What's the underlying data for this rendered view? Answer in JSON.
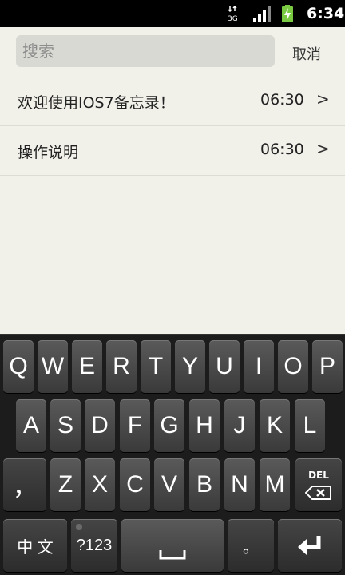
{
  "status_bar": {
    "network": "3G",
    "time": "6:34"
  },
  "search": {
    "placeholder": "搜索",
    "cancel_label": "取消"
  },
  "notes": [
    {
      "title": "欢迎使用IOS7备忘录！",
      "time": "06:30",
      "chevron": ">"
    },
    {
      "title": "操作说明",
      "time": "06:30",
      "chevron": ">"
    }
  ],
  "keyboard": {
    "row1": [
      "Q",
      "W",
      "E",
      "R",
      "T",
      "Y",
      "U",
      "I",
      "O",
      "P"
    ],
    "row2": [
      "A",
      "S",
      "D",
      "F",
      "G",
      "H",
      "J",
      "K",
      "L"
    ],
    "row3": [
      "Z",
      "X",
      "C",
      "V",
      "B",
      "N",
      "M"
    ],
    "comma": "，",
    "del_label": "DEL",
    "lang": "中 文",
    "numbers": "?123",
    "period": "。"
  }
}
